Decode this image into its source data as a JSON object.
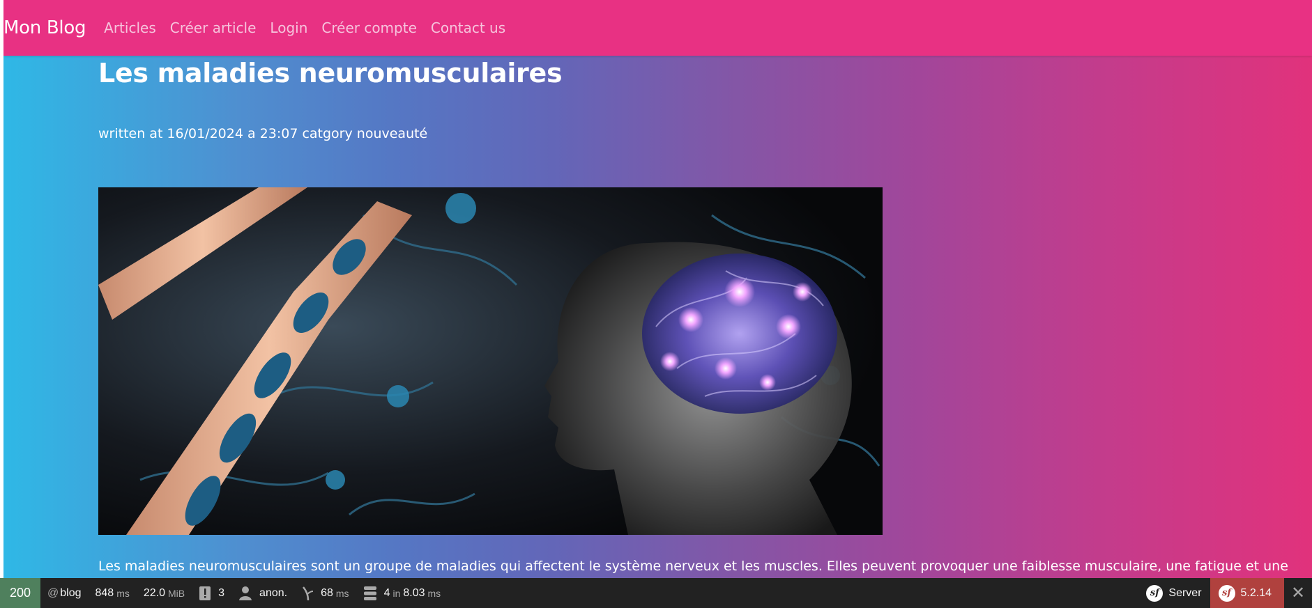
{
  "navbar": {
    "brand": "Mon Blog",
    "links": [
      "Articles",
      "Créer article",
      "Login",
      "Créer compte",
      "Contact us"
    ]
  },
  "article": {
    "title": "Les maladies neuromusculaires",
    "meta": "written at 16/01/2024 a 23:07 catgory nouveauté",
    "image_alt": "neuromuscular illustration",
    "excerpt": "Les maladies neuromusculaires sont un groupe de maladies qui affectent le système nerveux et les muscles. Elles peuvent provoquer une faiblesse musculaire, une fatigue et une"
  },
  "debug_toolbar": {
    "status_code": "200",
    "route_prefix": "@",
    "route": "blog",
    "time_value": "848",
    "time_unit": "ms",
    "memory_value": "22.0",
    "memory_unit": "MiB",
    "logs_count": "3",
    "user": "anon.",
    "twig_value": "68",
    "twig_unit": "ms",
    "db_queries": "4",
    "db_in": "in",
    "db_time": "8.03",
    "db_unit": "ms",
    "server_label": "Server",
    "symfony_version": "5.2.14",
    "sf_logo_text": "sf",
    "close_glyph": "✕"
  },
  "colors": {
    "navbar_bg": "#e83183",
    "gradient_left": "#2fb8e6",
    "gradient_right": "#e1327c",
    "toolbar_bg": "#222222",
    "status_ok": "#4f805d",
    "version_bg": "#b0413e"
  }
}
